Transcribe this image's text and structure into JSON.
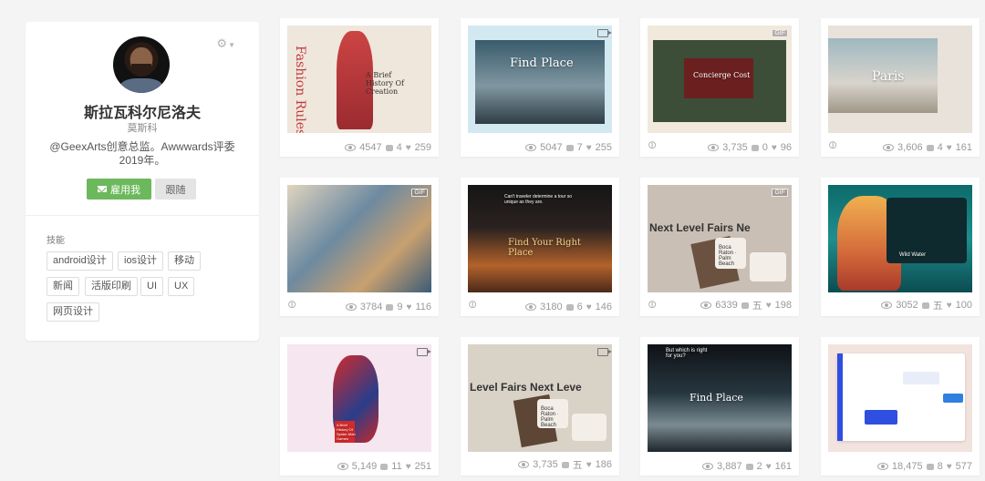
{
  "profile": {
    "name": "斯拉瓦科尔尼洛夫",
    "subname": "莫斯科",
    "bio": "@GeexArts创意总监。Awwwards评委2019年。",
    "hire_label": "雇用我",
    "follow_label": "跟随",
    "settings_icon": "gear-icon",
    "skills_title": "技能",
    "skills": [
      "android设计",
      "ios设计",
      "移动",
      "新闻",
      "活版印刷",
      "UI",
      "UX",
      "网页设计"
    ]
  },
  "cards": [
    {
      "title": "Fashion Rules",
      "subtitle": "A Brief History Of Creation",
      "views": "4547",
      "comments": "4",
      "likes": "259",
      "badge": "",
      "video": false,
      "link": false
    },
    {
      "title": "Find Place",
      "subtitle": "",
      "views": "5047",
      "comments": "7",
      "likes": "255",
      "badge": "",
      "video": true,
      "link": false
    },
    {
      "title": "Concierge Cost",
      "subtitle": "",
      "views": "3,735",
      "comments": "0",
      "likes": "96",
      "badge": "GIF",
      "video": false,
      "link": true
    },
    {
      "title": "Paris",
      "subtitle": "",
      "views": "3,606",
      "comments": "4",
      "likes": "161",
      "badge": "",
      "video": false,
      "link": true
    },
    {
      "title": "",
      "subtitle": "",
      "views": "3784",
      "comments": "9",
      "likes": "116",
      "badge": "GIF",
      "video": false,
      "link": true
    },
    {
      "title": "Find Your Right Place",
      "subtitle": "Can't traveler determine a tour so unique as they are.",
      "views": "3180",
      "comments": "6",
      "likes": "146",
      "badge": "",
      "video": false,
      "link": true
    },
    {
      "title": "Next Level Fairs Ne",
      "subtitle": "Boca Raton · Palm Beach",
      "views": "6339",
      "comments": "五",
      "likes": "198",
      "badge": "GIF",
      "video": false,
      "link": true
    },
    {
      "title": "Wild Water",
      "subtitle": "",
      "views": "3052",
      "comments": "五",
      "likes": "100",
      "badge": "",
      "video": false,
      "link": false
    },
    {
      "title": "A Brief History Of Spider-Man Games",
      "subtitle": "",
      "views": "5,149",
      "comments": "11",
      "likes": "251",
      "badge": "",
      "video": true,
      "link": false
    },
    {
      "title": "Level Fairs Next Leve",
      "subtitle": "Boca Raton · Palm Beach",
      "views": "3,735",
      "comments": "五",
      "likes": "186",
      "badge": "",
      "video": true,
      "link": false
    },
    {
      "title": "Find Place",
      "subtitle": "But which is right for you?",
      "views": "3,887",
      "comments": "2",
      "likes": "161",
      "badge": "",
      "video": false,
      "link": false
    },
    {
      "title": "",
      "subtitle": "",
      "views": "18,475",
      "comments": "8",
      "likes": "577",
      "badge": "",
      "video": false,
      "link": false
    }
  ]
}
